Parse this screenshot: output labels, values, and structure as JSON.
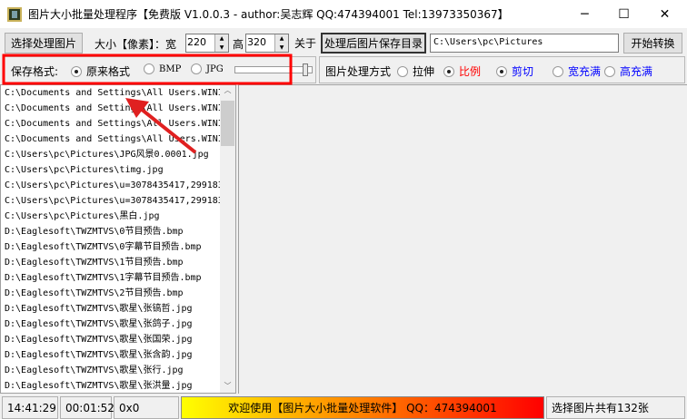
{
  "window": {
    "title": "图片大小批量处理程序【免费版 V1.0.0.3 - author:吴志辉  QQ:474394001 Tel:13973350367】",
    "minimize": "─",
    "maximize": "☐",
    "close": "✕"
  },
  "toolbar": {
    "select_button": "选择处理图片",
    "size_label": "大小【像素】：宽",
    "width_value": "220",
    "height_label": "高",
    "height_value": "320",
    "about_button": "关于",
    "save_dir_button": "处理后图片保存目录",
    "save_dir_value": "C:\\Users\\pc\\Pictures",
    "start_button": "开始转换"
  },
  "format": {
    "label": "保存格式:",
    "options": [
      {
        "label": "原来格式",
        "checked": true
      },
      {
        "label": "BMP",
        "checked": false
      },
      {
        "label": "JPG",
        "checked": false
      }
    ],
    "quality_fraction": 0.95
  },
  "processing": {
    "label": "图片处理方式",
    "options": [
      {
        "label": "拉伸",
        "checked": false,
        "color": "#000000"
      },
      {
        "label": "比例",
        "checked": true,
        "color": "#ff0000"
      },
      {
        "label": "剪切",
        "checked": true,
        "color": "#0000ff"
      },
      {
        "label": "宽充满",
        "checked": false,
        "color": "#0000ff"
      },
      {
        "label": "高充满",
        "checked": false,
        "color": "#0000ff"
      }
    ]
  },
  "files": [
    "C:\\Documents and Settings\\All Users.WINI",
    "C:\\Documents and Settings\\All Users.WINI",
    "C:\\Documents and Settings\\All Users.WINI",
    "C:\\Documents and Settings\\All Users.WINI",
    "C:\\Users\\pc\\Pictures\\JPG风景0.0001.jpg",
    "C:\\Users\\pc\\Pictures\\timg.jpg",
    "C:\\Users\\pc\\Pictures\\u=3078435417,299183",
    "C:\\Users\\pc\\Pictures\\u=3078435417,299183",
    "C:\\Users\\pc\\Pictures\\黑白.jpg",
    "D:\\Eaglesoft\\TWZMTVS\\0节目预告.bmp",
    "D:\\Eaglesoft\\TWZMTVS\\0字幕节目预告.bmp",
    "D:\\Eaglesoft\\TWZMTVS\\1节目预告.bmp",
    "D:\\Eaglesoft\\TWZMTVS\\1字幕节目预告.bmp",
    "D:\\Eaglesoft\\TWZMTVS\\2节目预告.bmp",
    "D:\\Eaglesoft\\TWZMTVS\\歌星\\张镐哲.jpg",
    "D:\\Eaglesoft\\TWZMTVS\\歌星\\张鸽子.jpg",
    "D:\\Eaglesoft\\TWZMTVS\\歌星\\张国荣.jpg",
    "D:\\Eaglesoft\\TWZMTVS\\歌星\\张含韵.jpg",
    "D:\\Eaglesoft\\TWZMTVS\\歌星\\张行.jpg",
    "D:\\Eaglesoft\\TWZMTVS\\歌星\\张洪量.jpg"
  ],
  "statusbar": {
    "time": "14:41:29",
    "elapsed": "00:01:52",
    "dimensions": "0x0",
    "welcome": "欢迎使用【图片大小批量处理软件】 QQ：474394001",
    "count": "选择图片共有132张"
  },
  "colors": {
    "highlight": "#ff0000",
    "arrow": "#e02020"
  }
}
